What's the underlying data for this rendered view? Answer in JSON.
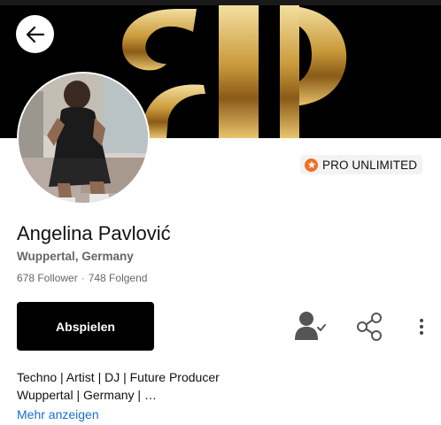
{
  "header": {
    "back_icon": "arrow-left-icon"
  },
  "profile": {
    "name": "Angelina Pavlović",
    "location": "Wuppertal, Germany",
    "followers": "678 Follower",
    "separator": "·",
    "following": "748 Folgend",
    "badge": {
      "icon": "star-icon",
      "label": "PRO UNLIMITED",
      "color": "#f26f23"
    }
  },
  "actions": {
    "play_label": "Abspielen",
    "follow_icon": "user-check-icon",
    "share_icon": "share-icon",
    "more_icon": "more-vertical-icon"
  },
  "bio": {
    "line1": "Techno | Artist | DJ | Future Producer",
    "line2": "Wuppertal | Germany |  …",
    "more_label": "Mehr anzeigen"
  },
  "colors": {
    "accent": "#f26f23",
    "link": "#1a6fd1",
    "banner_gold": "#d4a94a"
  }
}
